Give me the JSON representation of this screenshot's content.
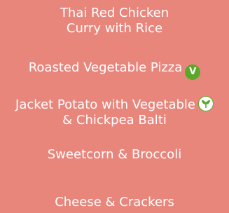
{
  "menu": {
    "items": [
      {
        "line1": "Thai Red Chicken",
        "line2": "Curry with Rice",
        "badge": null
      },
      {
        "line1": "Roasted Vegetable Pizza",
        "badge": "vegetarian",
        "badge_label": "V"
      },
      {
        "line1": "Jacket Potato with Vegetable",
        "line2": "& Chickpea Balti",
        "badge": "vegan"
      },
      {
        "line1": "Sweetcorn & Broccoli",
        "badge": null
      },
      {
        "line1": "Cheese & Crackers",
        "badge": null
      }
    ]
  },
  "colors": {
    "background": "#e8867c",
    "text": "#ffffff",
    "badge_green": "#5aa82a"
  }
}
